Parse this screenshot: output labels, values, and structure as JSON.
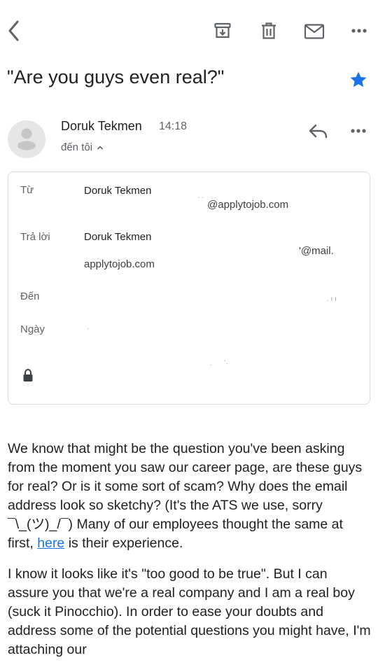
{
  "toolbar": {
    "back_icon": "chevron-left-icon",
    "archive_icon": "archive-icon",
    "delete_icon": "trash-icon",
    "mark_unread_icon": "envelope-icon",
    "more_icon": "more-horizontal-icon"
  },
  "email": {
    "subject": "\"Are you guys even real?\"",
    "starred": true,
    "star_color": "#1a73e8",
    "sender_name": "Doruk Tekmen",
    "time": "14:18",
    "recipient_summary": "đến tôi",
    "reply_icon": "reply-icon",
    "more_icon": "more-horizontal-icon"
  },
  "details": {
    "from_label": "Từ",
    "from_name": "Doruk Tekmen",
    "from_email": "@applytojob.com",
    "reply_to_label": "Trả lời",
    "reply_to_name": "Doruk Tekmen",
    "reply_to_email_end": "'@mail.",
    "reply_to_domain": "applytojob.com",
    "to_label": "Đến",
    "date_label": "Ngày",
    "security_icon": "lock-icon"
  },
  "body": {
    "p1_text": "We know that might be the question you've been asking from the moment you saw our career page, are these guys for real? Or is it some sort of scam? Why does the email address look so sketchy? (It's the ATS we use, sorry ¯\\_(ツ)_/¯) Many of our employees thought the same at first, ",
    "p1_link": "here",
    "p1_end": " is their experience.",
    "p2_text": "I know it looks like it's \"too good to be true\". But I can assure you that we're a real company and I am a real boy (suck it Pinocchio). In order to ease your doubts and address some of the potential questions you might have, I'm attaching our"
  },
  "colors": {
    "accent": "#1a73e8",
    "icon_gray": "#5f6368",
    "border": "#dadce0"
  }
}
